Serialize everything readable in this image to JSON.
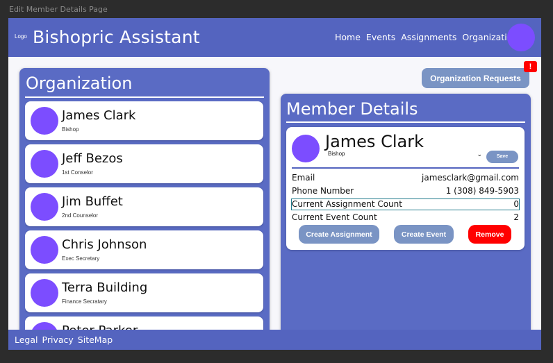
{
  "window": {
    "frame_label": "Edit Member Details Page"
  },
  "header": {
    "logo": "Logo",
    "title": "Bishopric Assistant",
    "nav": [
      "Home",
      "Events",
      "Assignments",
      "Organization"
    ]
  },
  "organization": {
    "title": "Organization",
    "members": [
      {
        "name": "James Clark",
        "role": "Bishop"
      },
      {
        "name": "Jeff Bezos",
        "role": "1st Conselor"
      },
      {
        "name": "Jim Buffet",
        "role": "2nd Counselor"
      },
      {
        "name": "Chris Johnson",
        "role": "Exec Secretary"
      },
      {
        "name": "Terra Building",
        "role": "Finance Secratary"
      },
      {
        "name": "Peter Parker",
        "role": ""
      }
    ]
  },
  "requests": {
    "label": "Organization Requests",
    "badge": "!"
  },
  "details": {
    "title": "Member Details",
    "name": "James Clark",
    "role_selected": "Bishop",
    "save_label": "Save",
    "rows": [
      {
        "label": "Email",
        "value": "jamesclark@gmail.com"
      },
      {
        "label": "Phone Number",
        "value": "1 (308) 849-5903"
      },
      {
        "label": "Current Assignment Count",
        "value": "0"
      },
      {
        "label": "Current Event Count",
        "value": "2"
      }
    ],
    "buttons": {
      "create_assignment": "Create Assignment",
      "create_event": "Create Event",
      "remove": "Remove"
    }
  },
  "footer": {
    "links": [
      "Legal",
      "Privacy",
      "SiteMap"
    ]
  },
  "colors": {
    "primary": "#5464bf",
    "panel": "#5a6bc4",
    "avatar": "#7c4dff",
    "button": "#7a94c4",
    "danger": "#ff0000"
  }
}
